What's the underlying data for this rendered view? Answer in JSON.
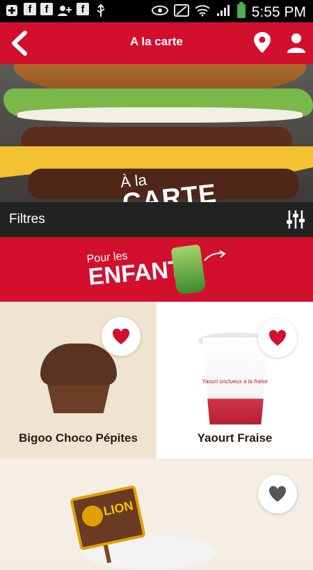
{
  "status_bar": {
    "time": "5:55 PM"
  },
  "header": {
    "title": "A la carte"
  },
  "hero": {
    "line1": "À la",
    "line2": "CARTE"
  },
  "filters": {
    "label": "Filtres"
  },
  "promo": {
    "line1": "Pour les",
    "line2": "ENFANTS"
  },
  "products": [
    {
      "name": "Bigoo Choco Pépites",
      "favorite": true
    },
    {
      "name": "Yaourt Fraise",
      "favorite": true,
      "cup_text": "Yaourt onctueux à la fraise"
    },
    {
      "name": "",
      "favorite": false,
      "sign": "LION"
    }
  ],
  "colors": {
    "brand_red": "#d2102e",
    "dark_bar": "#222222",
    "heart_active": "#d2102e",
    "heart_inactive": "#555555"
  }
}
